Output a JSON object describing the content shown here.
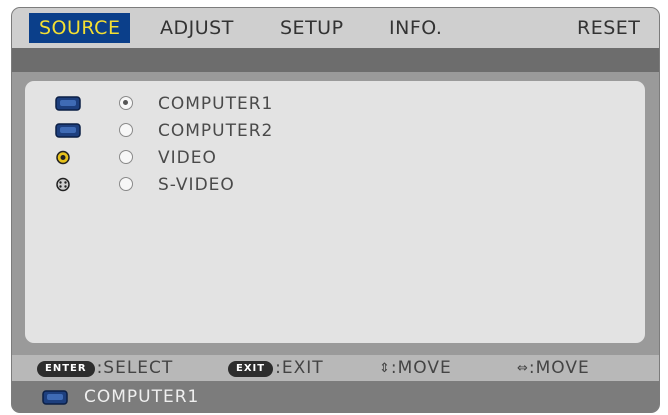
{
  "tabs": [
    {
      "label": "SOURCE",
      "active": true
    },
    {
      "label": "ADJUST",
      "active": false
    },
    {
      "label": "SETUP",
      "active": false
    },
    {
      "label": "INFO.",
      "active": false
    },
    {
      "label": "RESET",
      "active": false
    }
  ],
  "sources": [
    {
      "label": "COMPUTER1",
      "icon": "computer-port-icon",
      "selected": true
    },
    {
      "label": "COMPUTER2",
      "icon": "computer-port-icon",
      "selected": false
    },
    {
      "label": "VIDEO",
      "icon": "video-jack-icon",
      "selected": false
    },
    {
      "label": "S-VIDEO",
      "icon": "svideo-jack-icon",
      "selected": false
    }
  ],
  "hints": {
    "enter_key": "ENTER",
    "select": ":SELECT",
    "exit_key": "EXIT",
    "exit": ":EXIT",
    "move_vertical": ":MOVE",
    "move_horizontal": ":MOVE"
  },
  "footer": {
    "current_source": "COMPUTER1"
  },
  "colors": {
    "active_tab_bg": "#0b3f8a",
    "active_tab_text": "#f4df32"
  }
}
